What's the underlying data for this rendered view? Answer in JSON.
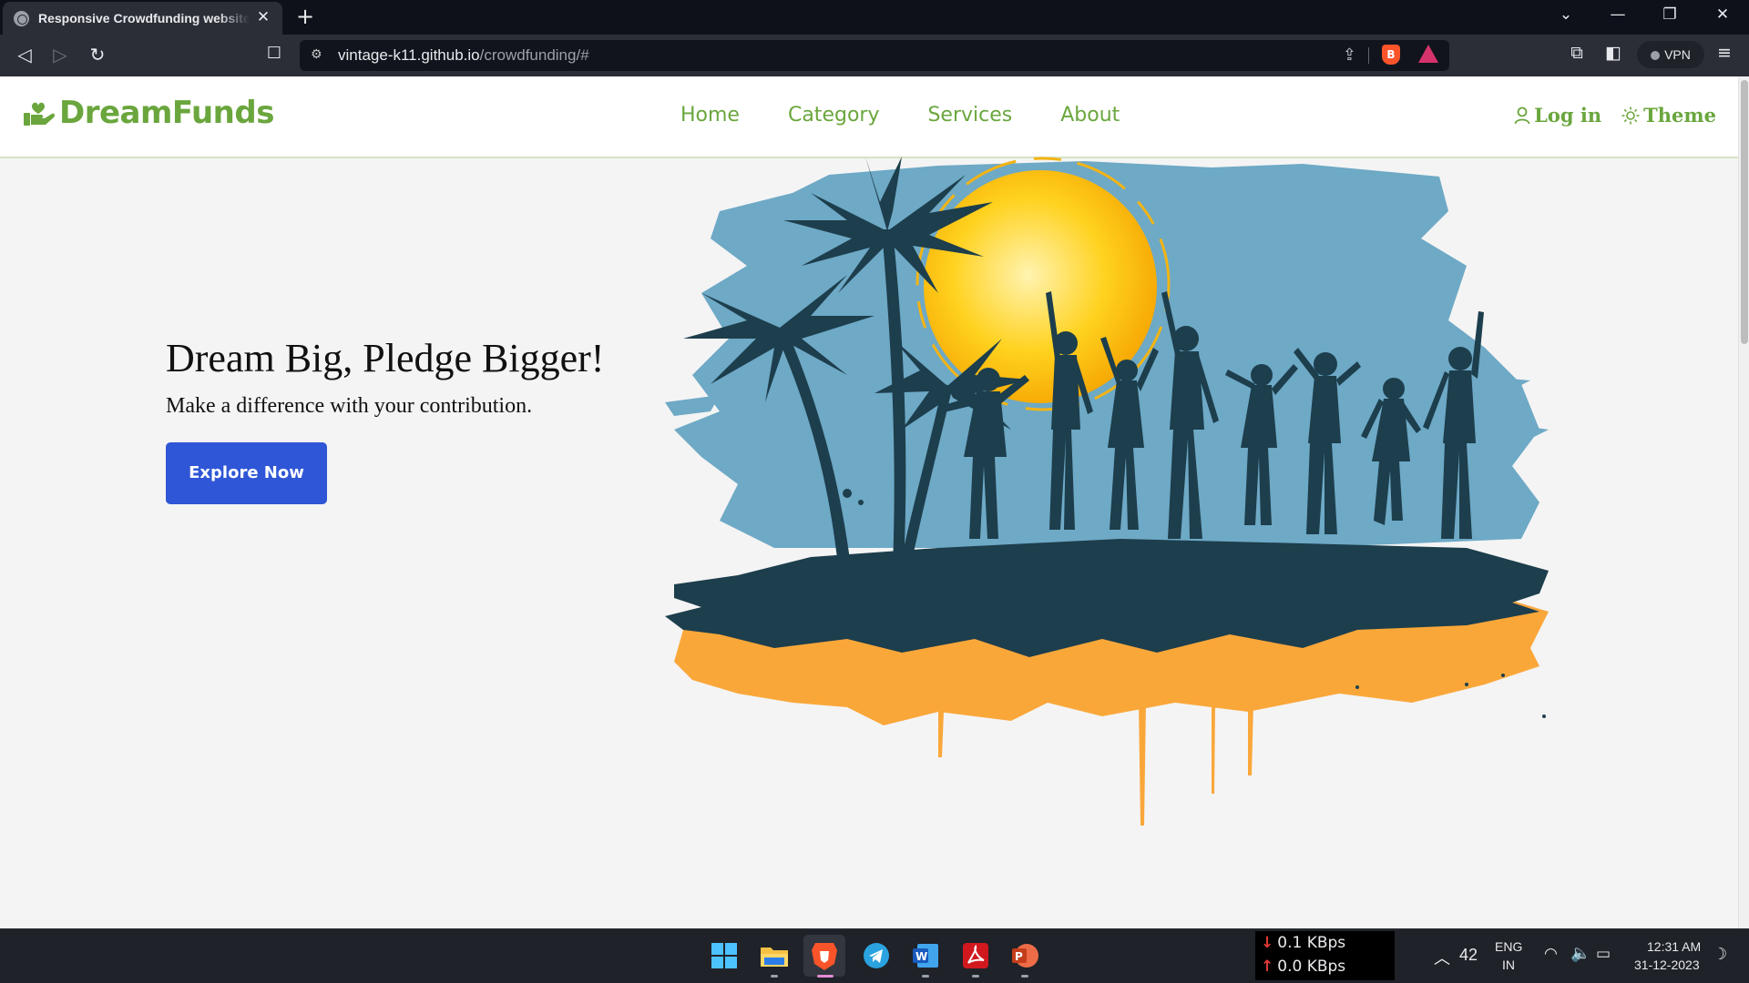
{
  "browser": {
    "tab_title": "Responsive Crowdfunding website",
    "url_host": "vintage-k11.github.io",
    "url_path": "/crowdfunding/#",
    "vpn_label": "VPN"
  },
  "site": {
    "brand": "DreamFunds",
    "nav": [
      "Home",
      "Category",
      "Services",
      "About"
    ],
    "login_label": "Log in",
    "theme_label": "Theme",
    "hero_title": "Dream Big, Pledge Bigger!",
    "hero_subtitle": "Make a difference with your contribution.",
    "cta_label": "Explore Now",
    "accent_color": "#6aa63d",
    "button_color": "#2f56d6"
  },
  "taskbar": {
    "apps": [
      "start-icon",
      "file-explorer-icon",
      "brave-browser-icon",
      "telegram-icon",
      "word-icon",
      "acrobat-icon",
      "powerpoint-icon"
    ],
    "net_down": "0.1 KBps",
    "net_up": "0.0 KBps",
    "weather_count": "42",
    "lang_top": "ENG",
    "lang_bottom": "IN",
    "time": "12:31 AM",
    "date": "31-12-2023"
  }
}
